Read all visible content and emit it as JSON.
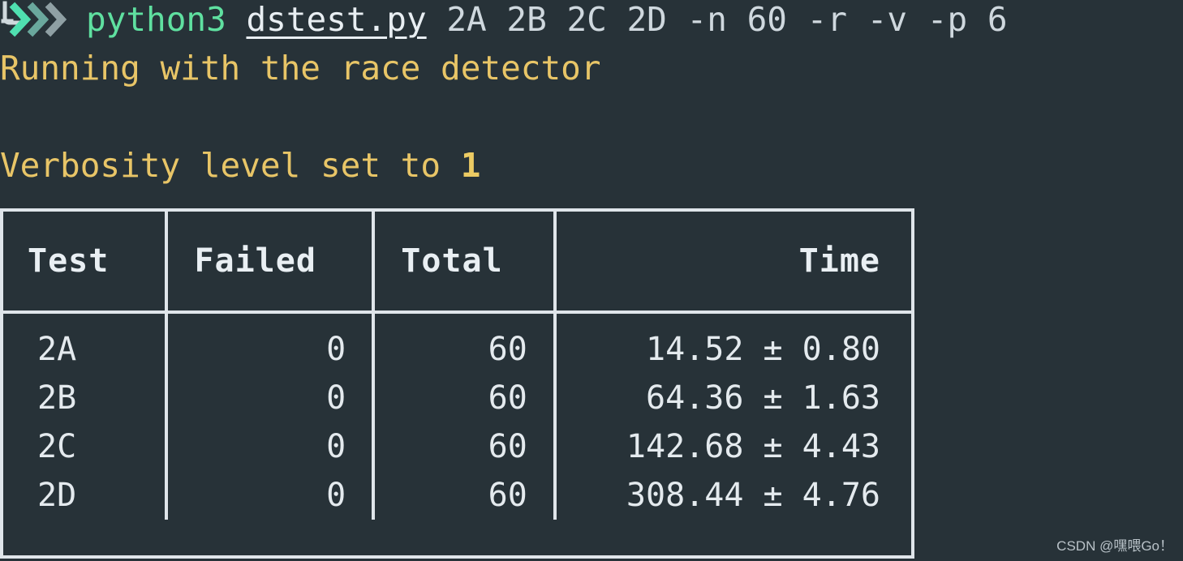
{
  "terminal": {
    "background_color": "#273238",
    "prompt": {
      "icon": "return-chevrons-prompt-icon",
      "colors": [
        "#4fe0b0",
        "#6aa89d",
        "#8fa0a4"
      ]
    },
    "command": {
      "program": "python3",
      "script": "dstest.py",
      "args": "2A 2B 2C 2D -n 60 -r -v -p 6",
      "program_color": "#5fe0a0",
      "script_color": "#e8eef2"
    },
    "output": {
      "race_detector_line": "Running with the race detector",
      "verbosity_prefix": "Verbosity level set to ",
      "verbosity_value": "1",
      "text_color": "#e8c567"
    }
  },
  "results_table": {
    "border_color": "#dfe5ea",
    "headers": [
      "Test",
      "Failed",
      "Total",
      "Time"
    ],
    "rows": [
      {
        "test": "2A",
        "failed": "0",
        "total": "60",
        "time": "14.52 ± 0.80"
      },
      {
        "test": "2B",
        "failed": "0",
        "total": "60",
        "time": "64.36 ± 1.63"
      },
      {
        "test": "2C",
        "failed": "0",
        "total": "60",
        "time": "142.68 ± 4.43"
      },
      {
        "test": "2D",
        "failed": "0",
        "total": "60",
        "time": "308.44 ± 4.76"
      }
    ],
    "test_name_color": "#5fe0a0"
  },
  "watermark": {
    "text": "CSDN @嘿喂Go！"
  }
}
